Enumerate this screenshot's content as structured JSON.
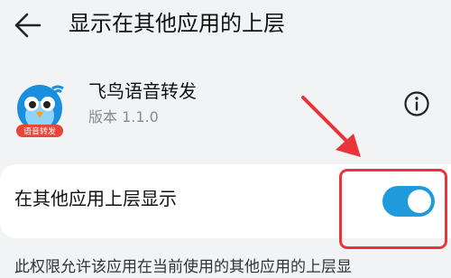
{
  "header": {
    "title": "显示在其他应用的上层"
  },
  "app": {
    "name": "飞鸟语音转发",
    "version": "版本 1.1.0",
    "icon_badge": "语音转发",
    "icon": "bird-app-icon"
  },
  "setting": {
    "label": "在其他应用上层显示",
    "enabled": true
  },
  "description": "此权限允许该应用在当前使用的其他应用的上层显",
  "colors": {
    "accent": "#1f9bdc",
    "highlight": "#e8353b",
    "background": "#f1f3f5"
  },
  "icons": [
    "back-arrow-icon",
    "info-icon",
    "bird-app-icon"
  ]
}
